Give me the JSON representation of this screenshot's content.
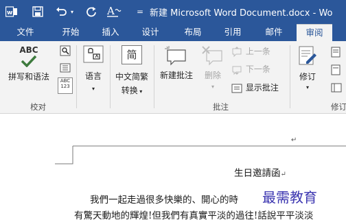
{
  "titlebar": {
    "title": "新建 Microsoft Word Document.docx - Wo",
    "qat_word": "w",
    "qat_save": "save-icon",
    "qat_undo": "undo-icon",
    "qat_redo": "redo-icon",
    "qat_font": "font-format-icon",
    "qat_more": "=",
    "bg_color": "#2b579a"
  },
  "tabs": [
    {
      "label": "文件"
    },
    {
      "label": "开始"
    },
    {
      "label": "插入"
    },
    {
      "label": "设计"
    },
    {
      "label": "布局"
    },
    {
      "label": "引用"
    },
    {
      "label": "邮件"
    },
    {
      "label": "审阅",
      "active": true
    }
  ],
  "ribbon": {
    "proofing": {
      "spelling_label": "拼写和语法",
      "spelling_icon_text": "ABC",
      "wordcount_icon_text": "ABC",
      "wordcount_icon_num": "123",
      "group_label": "校对"
    },
    "language": {
      "label": "语言",
      "group_label": ""
    },
    "chinese_conversion": {
      "label_line1": "中文简繁",
      "label_line2": "转换",
      "icon_char": "简"
    },
    "comments": {
      "new_comment": "新建批注",
      "delete": "删除",
      "previous": "上一条",
      "next": "下一条",
      "show_comments": "显示批注",
      "group_label": "批注"
    },
    "tracking": {
      "label": "修订",
      "group_label": "修订"
    }
  },
  "document": {
    "heading": "生日邀請函",
    "line1": "我們一起走過很多快樂的、開心的時",
    "line2": "有驚天動地的輝煌!但我們有真實平淡的過往!話說平平淡淡"
  },
  "watermark": "最需教育",
  "colors": {
    "accent": "#2b579a",
    "ribbon_bg": "#f3f3f3",
    "check_green": "#3d7a3d"
  }
}
